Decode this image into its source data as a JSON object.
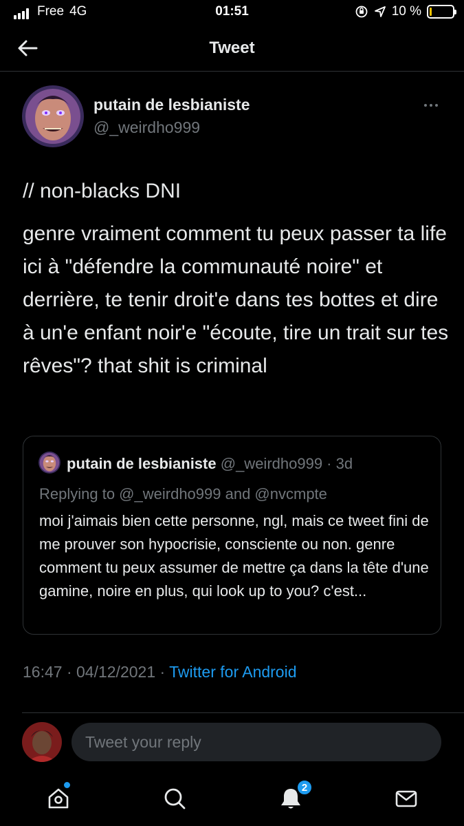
{
  "status_bar": {
    "carrier": "Free",
    "network": "4G",
    "time": "01:51",
    "battery_text": "10 %",
    "battery_level": 0.1
  },
  "header": {
    "back_icon": "arrow-left-icon",
    "title": "Tweet"
  },
  "tweet": {
    "author_name": "putain de lesbianiste",
    "author_handle": "@_weirdho999",
    "more_icon": "more-dots-icon",
    "paragraph_1": "// non-blacks DNI",
    "paragraph_2": "genre vraiment comment tu peux passer ta life ici à \"défendre la communauté noire\" et derrière, te tenir droit'e dans tes bottes et dire à un'e enfant noir'e \"écoute, tire un trait sur tes rêves\"? that shit is criminal",
    "timestamp": "16:47 · 04/12/2021 · ",
    "source": "Twitter for Android"
  },
  "quote": {
    "author_name": "putain de lesbianiste",
    "author_handle": "@_weirdho999 · 3d",
    "replying_to": "Replying to @_weirdho999 and @nvcmpte",
    "text": "moi j'aimais bien cette personne, ngl, mais ce tweet fini de me prouver son hypocrisie, consciente ou non. genre comment tu peux assumer de mettre ça dans la tête d'une gamine, noire en plus, qui look up to you? c'est..."
  },
  "reply": {
    "placeholder": "Tweet your reply"
  },
  "nav": {
    "items": [
      {
        "icon": "home-icon",
        "has_dot": true
      },
      {
        "icon": "search-icon"
      },
      {
        "icon": "notifications-bell-icon",
        "badge": "2"
      },
      {
        "icon": "messages-envelope-icon"
      }
    ]
  },
  "colors": {
    "background": "#000000",
    "accent": "#1d9bf0",
    "secondary_text": "#71767b",
    "battery": "#f5c400"
  }
}
